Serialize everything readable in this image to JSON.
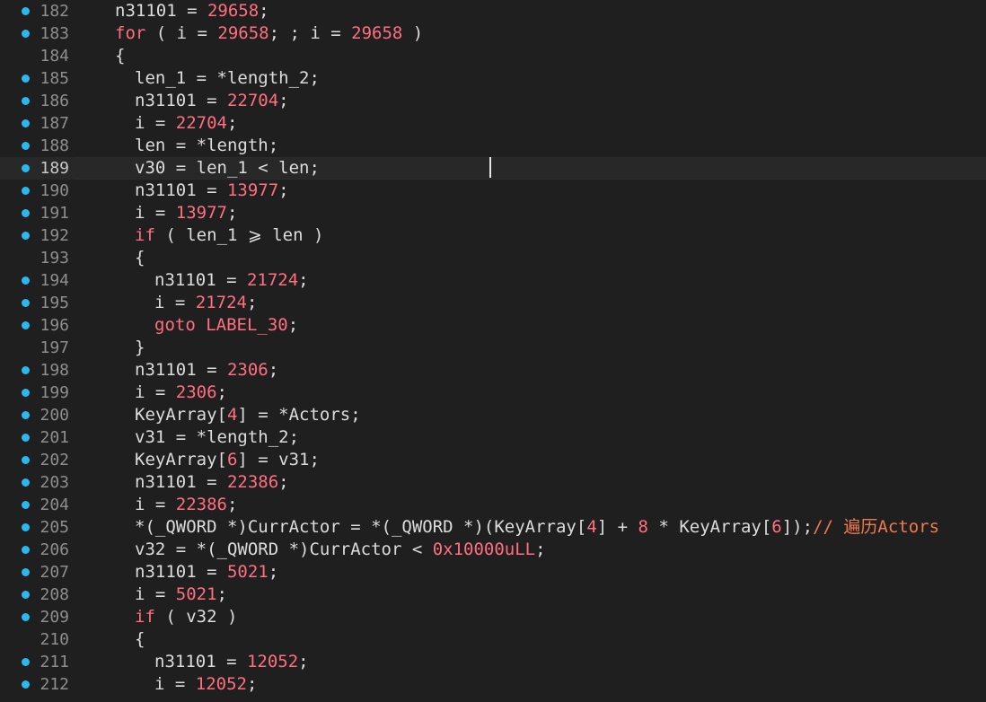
{
  "editor": {
    "cursor_line": 189,
    "colors": {
      "background": "#1f1f1f",
      "current_line": "#282828",
      "line_number": "#8e8e8e",
      "breakpoint_dot": "#2bb8ef",
      "default_text": "#dcdcdc",
      "keyword": "#ff6f80",
      "number": "#ff6f80",
      "comment": "#f07a50"
    },
    "lines": [
      {
        "num": "182",
        "bp": true,
        "indent": 0,
        "tokens": [
          [
            "n31101 = ",
            "default"
          ],
          [
            "29658",
            "number"
          ],
          [
            ";",
            "default"
          ]
        ]
      },
      {
        "num": "183",
        "bp": true,
        "indent": 0,
        "tokens": [
          [
            "for",
            "keyword"
          ],
          [
            " ( i = ",
            "default"
          ],
          [
            "29658",
            "number"
          ],
          [
            "; ; i = ",
            "default"
          ],
          [
            "29658",
            "number"
          ],
          [
            " )",
            "default"
          ]
        ]
      },
      {
        "num": "184",
        "bp": false,
        "indent": 0,
        "tokens": [
          [
            "{",
            "default"
          ]
        ]
      },
      {
        "num": "185",
        "bp": true,
        "indent": 1,
        "tokens": [
          [
            "len_1 = *length_2;",
            "default"
          ]
        ]
      },
      {
        "num": "186",
        "bp": true,
        "indent": 1,
        "tokens": [
          [
            "n31101 = ",
            "default"
          ],
          [
            "22704",
            "number"
          ],
          [
            ";",
            "default"
          ]
        ]
      },
      {
        "num": "187",
        "bp": true,
        "indent": 1,
        "tokens": [
          [
            "i = ",
            "default"
          ],
          [
            "22704",
            "number"
          ],
          [
            ";",
            "default"
          ]
        ]
      },
      {
        "num": "188",
        "bp": true,
        "indent": 1,
        "tokens": [
          [
            "len = *length;",
            "default"
          ]
        ]
      },
      {
        "num": "189",
        "bp": true,
        "indent": 1,
        "tokens": [
          [
            "v30 = len_1 < len;",
            "default"
          ]
        ]
      },
      {
        "num": "190",
        "bp": true,
        "indent": 1,
        "tokens": [
          [
            "n31101 = ",
            "default"
          ],
          [
            "13977",
            "number"
          ],
          [
            ";",
            "default"
          ]
        ]
      },
      {
        "num": "191",
        "bp": true,
        "indent": 1,
        "tokens": [
          [
            "i = ",
            "default"
          ],
          [
            "13977",
            "number"
          ],
          [
            ";",
            "default"
          ]
        ]
      },
      {
        "num": "192",
        "bp": true,
        "indent": 1,
        "tokens": [
          [
            "if",
            "keyword"
          ],
          [
            " ( len_1 ⩾ len )",
            "default"
          ]
        ]
      },
      {
        "num": "193",
        "bp": false,
        "indent": 1,
        "tokens": [
          [
            "{",
            "default"
          ]
        ]
      },
      {
        "num": "194",
        "bp": true,
        "indent": 2,
        "tokens": [
          [
            "n31101 = ",
            "default"
          ],
          [
            "21724",
            "number"
          ],
          [
            ";",
            "default"
          ]
        ]
      },
      {
        "num": "195",
        "bp": true,
        "indent": 2,
        "tokens": [
          [
            "i = ",
            "default"
          ],
          [
            "21724",
            "number"
          ],
          [
            ";",
            "default"
          ]
        ]
      },
      {
        "num": "196",
        "bp": true,
        "indent": 2,
        "tokens": [
          [
            "goto LABEL_30",
            "keyword"
          ],
          [
            ";",
            "default"
          ]
        ]
      },
      {
        "num": "197",
        "bp": false,
        "indent": 1,
        "tokens": [
          [
            "}",
            "default"
          ]
        ]
      },
      {
        "num": "198",
        "bp": true,
        "indent": 1,
        "tokens": [
          [
            "n31101 = ",
            "default"
          ],
          [
            "2306",
            "number"
          ],
          [
            ";",
            "default"
          ]
        ]
      },
      {
        "num": "199",
        "bp": true,
        "indent": 1,
        "tokens": [
          [
            "i = ",
            "default"
          ],
          [
            "2306",
            "number"
          ],
          [
            ";",
            "default"
          ]
        ]
      },
      {
        "num": "200",
        "bp": true,
        "indent": 1,
        "tokens": [
          [
            "KeyArray[",
            "default"
          ],
          [
            "4",
            "number"
          ],
          [
            "] = *Actors;",
            "default"
          ]
        ]
      },
      {
        "num": "201",
        "bp": true,
        "indent": 1,
        "tokens": [
          [
            "v31 = *length_2;",
            "default"
          ]
        ]
      },
      {
        "num": "202",
        "bp": true,
        "indent": 1,
        "tokens": [
          [
            "KeyArray[",
            "default"
          ],
          [
            "6",
            "number"
          ],
          [
            "] = v31;",
            "default"
          ]
        ]
      },
      {
        "num": "203",
        "bp": true,
        "indent": 1,
        "tokens": [
          [
            "n31101 = ",
            "default"
          ],
          [
            "22386",
            "number"
          ],
          [
            ";",
            "default"
          ]
        ]
      },
      {
        "num": "204",
        "bp": true,
        "indent": 1,
        "tokens": [
          [
            "i = ",
            "default"
          ],
          [
            "22386",
            "number"
          ],
          [
            ";",
            "default"
          ]
        ]
      },
      {
        "num": "205",
        "bp": true,
        "indent": 1,
        "tokens": [
          [
            "*(_QWORD *)CurrActor = *(_QWORD *)(KeyArray[",
            "default"
          ],
          [
            "4",
            "number"
          ],
          [
            "] + ",
            "default"
          ],
          [
            "8",
            "number"
          ],
          [
            " * KeyArray[",
            "default"
          ],
          [
            "6",
            "number"
          ],
          [
            "]);",
            "default"
          ],
          [
            "// 遍历Actors",
            "comment"
          ]
        ]
      },
      {
        "num": "206",
        "bp": true,
        "indent": 1,
        "tokens": [
          [
            "v32 = *(_QWORD *)CurrActor < ",
            "default"
          ],
          [
            "0x10000uLL",
            "number"
          ],
          [
            ";",
            "default"
          ]
        ]
      },
      {
        "num": "207",
        "bp": true,
        "indent": 1,
        "tokens": [
          [
            "n31101 = ",
            "default"
          ],
          [
            "5021",
            "number"
          ],
          [
            ";",
            "default"
          ]
        ]
      },
      {
        "num": "208",
        "bp": true,
        "indent": 1,
        "tokens": [
          [
            "i = ",
            "default"
          ],
          [
            "5021",
            "number"
          ],
          [
            ";",
            "default"
          ]
        ]
      },
      {
        "num": "209",
        "bp": true,
        "indent": 1,
        "tokens": [
          [
            "if",
            "keyword"
          ],
          [
            " ( v32 )",
            "default"
          ]
        ]
      },
      {
        "num": "210",
        "bp": false,
        "indent": 1,
        "tokens": [
          [
            "{",
            "default"
          ]
        ]
      },
      {
        "num": "211",
        "bp": true,
        "indent": 2,
        "tokens": [
          [
            "n31101 = ",
            "default"
          ],
          [
            "12052",
            "number"
          ],
          [
            ";",
            "default"
          ]
        ]
      },
      {
        "num": "212",
        "bp": true,
        "indent": 2,
        "tokens": [
          [
            "i = ",
            "default"
          ],
          [
            "12052",
            "number"
          ],
          [
            ";",
            "default"
          ]
        ]
      }
    ]
  }
}
